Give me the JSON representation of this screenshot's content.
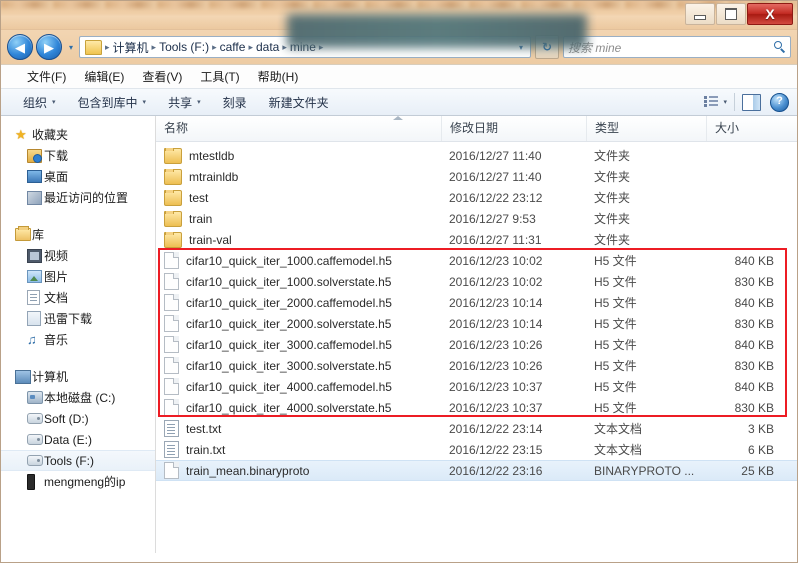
{
  "window": {
    "controls": {
      "minimize": "–",
      "maximize": "□",
      "close": "X"
    }
  },
  "address_bar": {
    "back_icon": "◀",
    "forward_icon": "▶",
    "history_caret": "▾",
    "folder_icon": "folder-icon",
    "breadcrumbs": [
      "计算机",
      "Tools (F:)",
      "caffe",
      "data",
      "mine"
    ],
    "separator": "▸",
    "dropdown_caret": "▾",
    "refresh_icon": "↻",
    "search": {
      "placeholder": "搜索 mine",
      "value": ""
    }
  },
  "menu_bar": {
    "items": [
      {
        "label": "文件(F)"
      },
      {
        "label": "编辑(E)"
      },
      {
        "label": "查看(V)"
      },
      {
        "label": "工具(T)"
      },
      {
        "label": "帮助(H)"
      }
    ]
  },
  "command_bar": {
    "items": [
      {
        "label": "组织",
        "caret": "▾"
      },
      {
        "label": "包含到库中",
        "caret": "▾"
      },
      {
        "label": "共享",
        "caret": "▾"
      },
      {
        "label": "刻录",
        "caret": ""
      },
      {
        "label": "新建文件夹",
        "caret": ""
      }
    ],
    "view_caret": "▾",
    "help_label": "?"
  },
  "sidebar": {
    "groups": [
      {
        "header": {
          "label": "收藏夹",
          "icon": "star-icon"
        },
        "items": [
          {
            "label": "下载",
            "icon": "downloads-icon"
          },
          {
            "label": "桌面",
            "icon": "desktop-icon"
          },
          {
            "label": "最近访问的位置",
            "icon": "recent-places-icon"
          }
        ]
      },
      {
        "header": {
          "label": "库",
          "icon": "library-icon"
        },
        "items": [
          {
            "label": "视频",
            "icon": "videos-icon"
          },
          {
            "label": "图片",
            "icon": "pictures-icon"
          },
          {
            "label": "文档",
            "icon": "documents-icon"
          },
          {
            "label": "迅雷下载",
            "icon": "thunder-download-icon"
          },
          {
            "label": "音乐",
            "icon": "music-icon"
          }
        ]
      },
      {
        "header": {
          "label": "计算机",
          "icon": "computer-icon"
        },
        "items": [
          {
            "label": "本地磁盘 (C:)",
            "icon": "system-drive-icon",
            "selected": false
          },
          {
            "label": "Soft (D:)",
            "icon": "drive-icon",
            "selected": false
          },
          {
            "label": "Data (E:)",
            "icon": "drive-icon",
            "selected": false
          },
          {
            "label": "Tools (F:)",
            "icon": "drive-icon",
            "selected": true
          },
          {
            "label": "mengmeng的ip",
            "icon": "phone-icon",
            "selected": false
          }
        ]
      }
    ]
  },
  "file_list": {
    "columns": [
      {
        "key": "name",
        "label": "名称",
        "sorted": true
      },
      {
        "key": "date",
        "label": "修改日期"
      },
      {
        "key": "type",
        "label": "类型"
      },
      {
        "key": "size",
        "label": "大小"
      }
    ],
    "rows": [
      {
        "name": "mtestldb",
        "date": "2016/12/27 11:40",
        "type": "文件夹",
        "size": "",
        "icon": "folder",
        "selected": false
      },
      {
        "name": "mtrainldb",
        "date": "2016/12/27 11:40",
        "type": "文件夹",
        "size": "",
        "icon": "folder",
        "selected": false
      },
      {
        "name": "test",
        "date": "2016/12/22 23:12",
        "type": "文件夹",
        "size": "",
        "icon": "folder",
        "selected": false
      },
      {
        "name": "train",
        "date": "2016/12/27 9:53",
        "type": "文件夹",
        "size": "",
        "icon": "folder",
        "selected": false
      },
      {
        "name": "train-val",
        "date": "2016/12/27 11:31",
        "type": "文件夹",
        "size": "",
        "icon": "folder",
        "selected": false
      },
      {
        "name": "cifar10_quick_iter_1000.caffemodel.h5",
        "date": "2016/12/23 10:02",
        "type": "H5 文件",
        "size": "840 KB",
        "icon": "h5",
        "selected": false
      },
      {
        "name": "cifar10_quick_iter_1000.solverstate.h5",
        "date": "2016/12/23 10:02",
        "type": "H5 文件",
        "size": "830 KB",
        "icon": "h5",
        "selected": false
      },
      {
        "name": "cifar10_quick_iter_2000.caffemodel.h5",
        "date": "2016/12/23 10:14",
        "type": "H5 文件",
        "size": "840 KB",
        "icon": "h5",
        "selected": false
      },
      {
        "name": "cifar10_quick_iter_2000.solverstate.h5",
        "date": "2016/12/23 10:14",
        "type": "H5 文件",
        "size": "830 KB",
        "icon": "h5",
        "selected": false
      },
      {
        "name": "cifar10_quick_iter_3000.caffemodel.h5",
        "date": "2016/12/23 10:26",
        "type": "H5 文件",
        "size": "840 KB",
        "icon": "h5",
        "selected": false
      },
      {
        "name": "cifar10_quick_iter_3000.solverstate.h5",
        "date": "2016/12/23 10:26",
        "type": "H5 文件",
        "size": "830 KB",
        "icon": "h5",
        "selected": false
      },
      {
        "name": "cifar10_quick_iter_4000.caffemodel.h5",
        "date": "2016/12/23 10:37",
        "type": "H5 文件",
        "size": "840 KB",
        "icon": "h5",
        "selected": false
      },
      {
        "name": "cifar10_quick_iter_4000.solverstate.h5",
        "date": "2016/12/23 10:37",
        "type": "H5 文件",
        "size": "830 KB",
        "icon": "h5",
        "selected": false
      },
      {
        "name": "test.txt",
        "date": "2016/12/22 23:14",
        "type": "文本文档",
        "size": "3 KB",
        "icon": "txt",
        "selected": false
      },
      {
        "name": "train.txt",
        "date": "2016/12/22 23:15",
        "type": "文本文档",
        "size": "6 KB",
        "icon": "txt",
        "selected": false
      },
      {
        "name": "train_mean.binaryproto",
        "date": "2016/12/22 23:16",
        "type": "BINARYPROTO ...",
        "size": "25 KB",
        "icon": "bin",
        "selected": true
      }
    ],
    "annotation": {
      "color": "#ed1c24",
      "first_row_index": 5,
      "last_row_index": 12
    }
  }
}
